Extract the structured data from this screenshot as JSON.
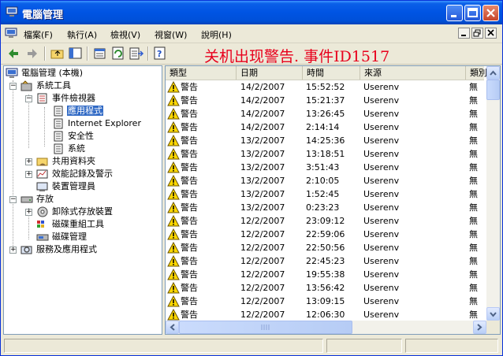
{
  "window": {
    "title": "電腦管理"
  },
  "menu": [
    {
      "label": "檔案(F)"
    },
    {
      "label": "執行(A)"
    },
    {
      "label": "檢視(V)"
    },
    {
      "label": "視窗(W)"
    },
    {
      "label": "說明(H)"
    }
  ],
  "overlay_text": "关机出现警告. 事件ID1517",
  "tree": {
    "root": "電腦管理 (本機)",
    "system_tools": "系統工具",
    "event_viewer": "事件檢視器",
    "application": "應用程式",
    "internet_explorer": "Internet Explorer",
    "security": "安全性",
    "system": "系統",
    "shared_folders": "共用資料夾",
    "perf_logs": "效能記錄及警示",
    "device_manager": "裝置管理員",
    "storage": "存放",
    "removable_storage": "卸除式存放裝置",
    "defrag": "磁碟重組工具",
    "disk_mgmt": "磁碟管理",
    "services_apps": "服務及應用程式"
  },
  "list": {
    "columns": [
      "類型",
      "日期",
      "時間",
      "來源",
      "類別"
    ],
    "rows": [
      {
        "type": "警告",
        "date": "14/2/2007",
        "time": "15:52:52",
        "source": "Userenv",
        "category": "無"
      },
      {
        "type": "警告",
        "date": "14/2/2007",
        "time": "15:21:37",
        "source": "Userenv",
        "category": "無"
      },
      {
        "type": "警告",
        "date": "14/2/2007",
        "time": "13:26:45",
        "source": "Userenv",
        "category": "無"
      },
      {
        "type": "警告",
        "date": "14/2/2007",
        "time": "2:14:14",
        "source": "Userenv",
        "category": "無"
      },
      {
        "type": "警告",
        "date": "13/2/2007",
        "time": "14:25:36",
        "source": "Userenv",
        "category": "無"
      },
      {
        "type": "警告",
        "date": "13/2/2007",
        "time": "13:18:51",
        "source": "Userenv",
        "category": "無"
      },
      {
        "type": "警告",
        "date": "13/2/2007",
        "time": "3:51:43",
        "source": "Userenv",
        "category": "無"
      },
      {
        "type": "警告",
        "date": "13/2/2007",
        "time": "2:10:05",
        "source": "Userenv",
        "category": "無"
      },
      {
        "type": "警告",
        "date": "13/2/2007",
        "time": "1:52:45",
        "source": "Userenv",
        "category": "無"
      },
      {
        "type": "警告",
        "date": "13/2/2007",
        "time": "0:23:23",
        "source": "Userenv",
        "category": "無"
      },
      {
        "type": "警告",
        "date": "12/2/2007",
        "time": "23:09:12",
        "source": "Userenv",
        "category": "無"
      },
      {
        "type": "警告",
        "date": "12/2/2007",
        "time": "22:59:06",
        "source": "Userenv",
        "category": "無"
      },
      {
        "type": "警告",
        "date": "12/2/2007",
        "time": "22:50:56",
        "source": "Userenv",
        "category": "無"
      },
      {
        "type": "警告",
        "date": "12/2/2007",
        "time": "22:45:23",
        "source": "Userenv",
        "category": "無"
      },
      {
        "type": "警告",
        "date": "12/2/2007",
        "time": "19:55:38",
        "source": "Userenv",
        "category": "無"
      },
      {
        "type": "警告",
        "date": "12/2/2007",
        "time": "13:56:42",
        "source": "Userenv",
        "category": "無"
      },
      {
        "type": "警告",
        "date": "12/2/2007",
        "time": "13:09:15",
        "source": "Userenv",
        "category": "無"
      },
      {
        "type": "警告",
        "date": "12/2/2007",
        "time": "12:06:30",
        "source": "Userenv",
        "category": "無"
      }
    ]
  },
  "icons": {
    "warning": "warning-triangle-icon",
    "back": "back-arrow-icon",
    "forward": "forward-arrow-icon"
  },
  "colors": {
    "accent": "#0054E3",
    "selection": "#316AC5",
    "overlay": "#E8001C",
    "warning": "#FFD800"
  }
}
